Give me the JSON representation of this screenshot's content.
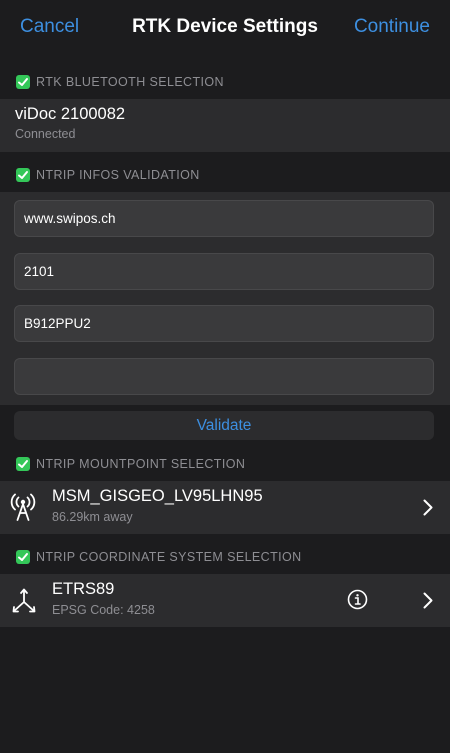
{
  "nav": {
    "cancel": "Cancel",
    "title": "RTK Device Settings",
    "continue": "Continue"
  },
  "sections": {
    "bluetooth": "RTK BLUETOOTH SELECTION",
    "ntrip_infos": "NTRIP INFOS VALIDATION",
    "mountpoint": "NTRIP MOUNTPOINT SELECTION",
    "coordinate": "NTRIP COORDINATE SYSTEM SELECTION"
  },
  "device": {
    "name": "viDoc  2100082",
    "status": "Connected"
  },
  "ntrip": {
    "host": "www.swipos.ch",
    "port": "2101",
    "username": "B912PPU2",
    "password": ""
  },
  "validate_label": "Validate",
  "mountpoint": {
    "name": "MSM_GISGEO_LV95LHN95",
    "distance": "86.29km away"
  },
  "coordinate_system": {
    "name": "ETRS89",
    "epsg": "EPSG Code: 4258"
  },
  "colors": {
    "accent": "#3d8fe0",
    "check": "#34c759",
    "background": "#1c1c1e",
    "cell": "#2c2c2e"
  },
  "icons": [
    "checkmark-icon",
    "antenna-icon",
    "axes-icon",
    "info-icon",
    "chevron-right-icon"
  ]
}
